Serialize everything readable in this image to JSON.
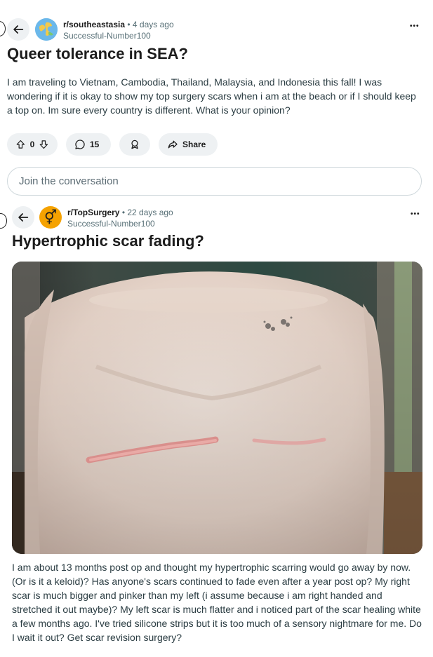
{
  "post1": {
    "subreddit": "r/southeastasia",
    "age": "• 4 days ago",
    "username": "Successful-Number100",
    "title": "Queer tolerance in SEA?",
    "body": "I am traveling to Vietnam, Cambodia, Thailand, Malaysia, and Indonesia this fall! I was wondering if it is okay to show my top surgery scars when i am at the beach or if I should keep a top on. Im sure every country is different. What is your opinion?",
    "votes": "0",
    "comments": "15",
    "share_label": "Share",
    "join_placeholder": "Join the conversation",
    "more": "•••"
  },
  "post2": {
    "subreddit": "r/TopSurgery",
    "age": "• 22 days ago",
    "username": "Successful-Number100",
    "title": "Hypertrophic scar fading?",
    "body": "I am about 13 months post op and thought my hypertrophic scarring would go away by now. (Or is it a keloid)? Has anyone's scars continued to fade even after a year post op? My right scar is much bigger and pinker than my left (i assume because i am right handed and stretched it out maybe)? My left scar is much flatter and i noticed part of the scar healing white a few months ago. I've tried silicone strips but it is too much of a sensory nightmare for me. Do I wait it out? Get scar revision surgery?",
    "more": "•••",
    "avatar_symbol": "⚥"
  },
  "icons": {
    "back": "back-arrow-icon",
    "upvote": "upvote-icon",
    "downvote": "downvote-icon",
    "comment": "comment-icon",
    "award": "award-icon",
    "share": "share-icon",
    "more": "more-options-icon"
  },
  "colors": {
    "pill_bg": "#eef1f3",
    "text_secondary": "#576f76",
    "topsurgery_avatar": "#f5a200"
  }
}
